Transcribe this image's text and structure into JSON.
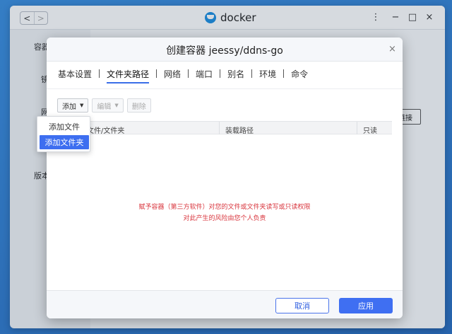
{
  "app": {
    "title": "docker",
    "nav_back": "<",
    "nav_forward": ">",
    "controls": {
      "menu": "⋮",
      "minimize": "−",
      "maximize": "□",
      "close": "×"
    }
  },
  "background": {
    "sidebar_items": [
      "容器",
      "镜",
      "网",
      "版本"
    ],
    "side_button": "链接"
  },
  "dialog": {
    "title": "创建容器 jeessy/ddns-go",
    "close": "×",
    "tabs": [
      {
        "label": "基本设置",
        "active": false
      },
      {
        "label": "文件夹路径",
        "active": true
      },
      {
        "label": "网络",
        "active": false
      },
      {
        "label": "端口",
        "active": false
      },
      {
        "label": "别名",
        "active": false
      },
      {
        "label": "环境",
        "active": false
      },
      {
        "label": "命令",
        "active": false
      }
    ],
    "toolbar": {
      "add": "添加",
      "edit": "编辑",
      "delete": "删除",
      "caret": "▼"
    },
    "table": {
      "columns": [
        "文件/文件夹",
        "装载路径",
        "只读"
      ]
    },
    "warning": {
      "line1": "赋予容器（第三方软件）对您的文件或文件夹读写或只读权限",
      "line2": "对此产生的风险由您个人负责"
    },
    "footer": {
      "cancel": "取消",
      "apply": "应用"
    }
  },
  "dropdown": {
    "items": [
      {
        "label": "添加文件",
        "selected": false
      },
      {
        "label": "添加文件夹",
        "selected": true
      }
    ]
  },
  "colors": {
    "accent": "#3f6ff2",
    "warning": "#d9363e",
    "desktop": "#2f7fd3"
  }
}
